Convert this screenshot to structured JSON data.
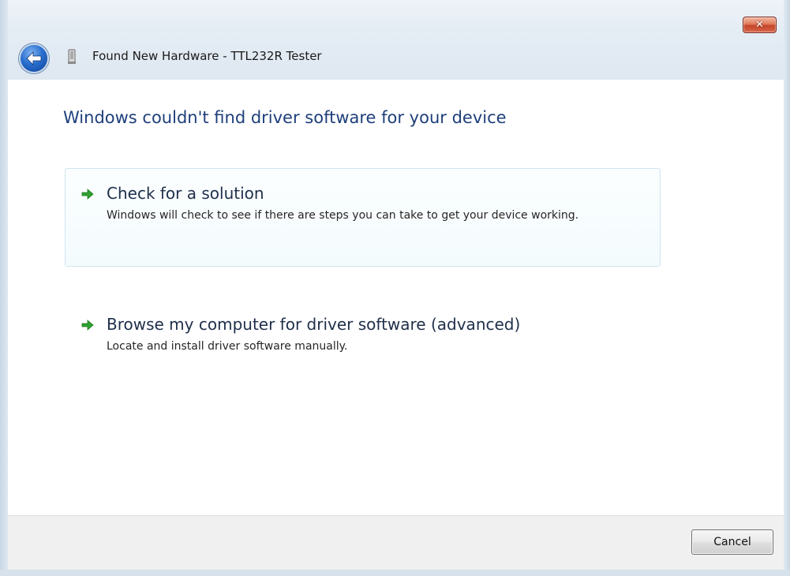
{
  "window": {
    "title": "Found New Hardware - TTL232R Tester",
    "close_label": "✕",
    "back_icon": "back-arrow-icon",
    "device_icon": "usb-device-icon"
  },
  "main": {
    "heading": "Windows couldn't find driver software for your device",
    "options": [
      {
        "title": "Check for a solution",
        "description": "Windows will check to see if there are steps you can take to get your device working.",
        "icon": "green-arrow-icon"
      },
      {
        "title": "Browse my computer for driver software (advanced)",
        "description": "Locate and install driver software manually.",
        "icon": "green-arrow-icon"
      }
    ]
  },
  "footer": {
    "cancel_label": "Cancel"
  },
  "colors": {
    "heading": "#1e3f7a",
    "arrow": "#2fa12f",
    "close": "#c4452a"
  }
}
